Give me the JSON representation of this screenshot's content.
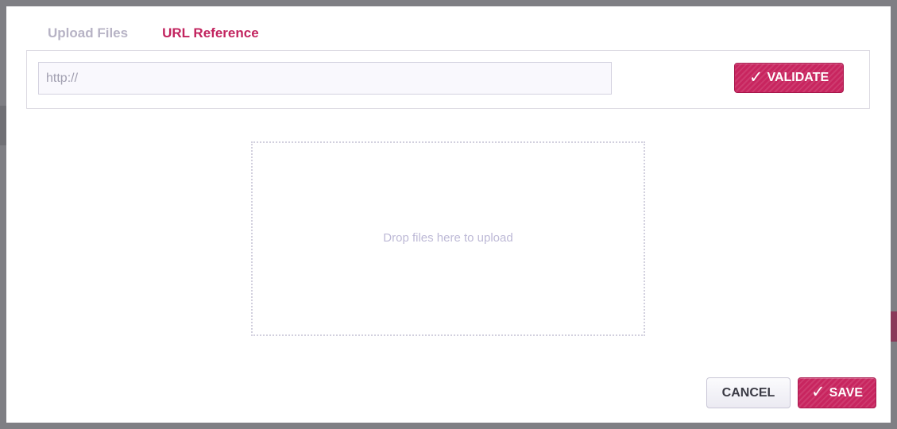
{
  "tabs": [
    {
      "label": "Upload Files",
      "active": false
    },
    {
      "label": "URL Reference",
      "active": true
    }
  ],
  "url_field": {
    "value": "",
    "placeholder": "http://"
  },
  "validate_button": {
    "label": "VALIDATE",
    "icon": "checkmark-icon"
  },
  "dropzone": {
    "text": "Drop files here to upload"
  },
  "footer": {
    "cancel_label": "CANCEL",
    "save_label": "SAVE",
    "save_icon": "checkmark-icon"
  },
  "colors": {
    "accent": "#c8255f",
    "tab_active": "#c2245f",
    "tab_inactive": "#b7b3c5",
    "overlay": "#8a8a8e"
  }
}
